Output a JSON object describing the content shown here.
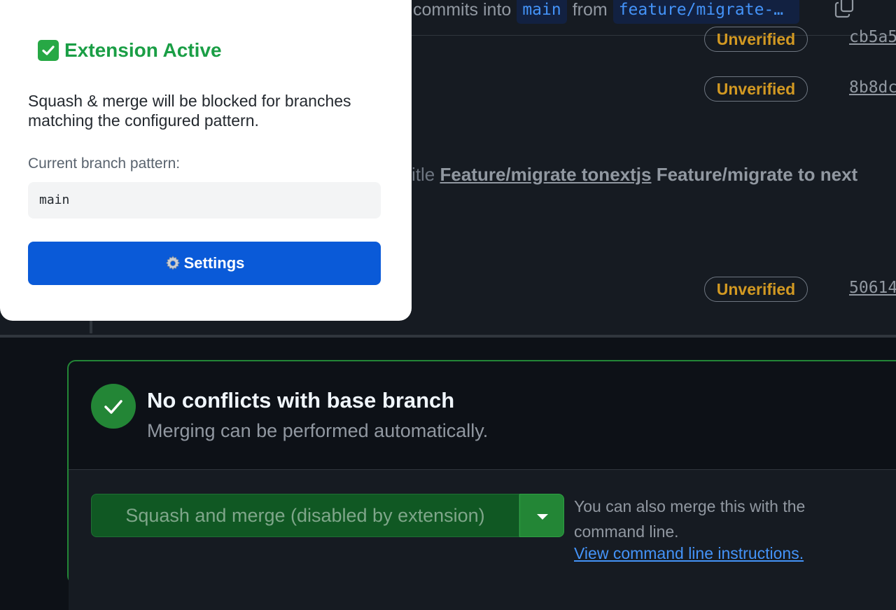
{
  "popup": {
    "status_title": "Extension Active",
    "description": "Squash & merge will be blocked for branches matching the configured pattern.",
    "pattern_label": "Current branch pattern:",
    "pattern_value": "main",
    "settings_label": "Settings",
    "icons": {
      "status": "check-mark-button-icon",
      "settings": "gear-icon"
    },
    "colors": {
      "status": "#1a9e45",
      "button": "#0a5ad8"
    }
  },
  "pr_header": {
    "text_commits_into": "commits into",
    "base_branch": "main",
    "text_from": "from",
    "head_branch": "feature/migrate-…"
  },
  "commits": [
    {
      "badge": "Unverified",
      "sha": "cb5a5"
    },
    {
      "badge": "Unverified",
      "sha": "8b8dc"
    },
    {
      "badge": "Unverified",
      "sha": "50614"
    }
  ],
  "title_change": {
    "prefix": "itle",
    "old_title": "Feature/migrate tonextjs",
    "new_title": "Feature/migrate to next"
  },
  "merge_box": {
    "title": "No conflicts with base branch",
    "subtitle": "Merging can be performed automatically.",
    "squash_button": "Squash and merge (disabled by extension)",
    "cmd_text": "You can also merge this with the command line.",
    "cmd_link": "View command line instructions."
  }
}
